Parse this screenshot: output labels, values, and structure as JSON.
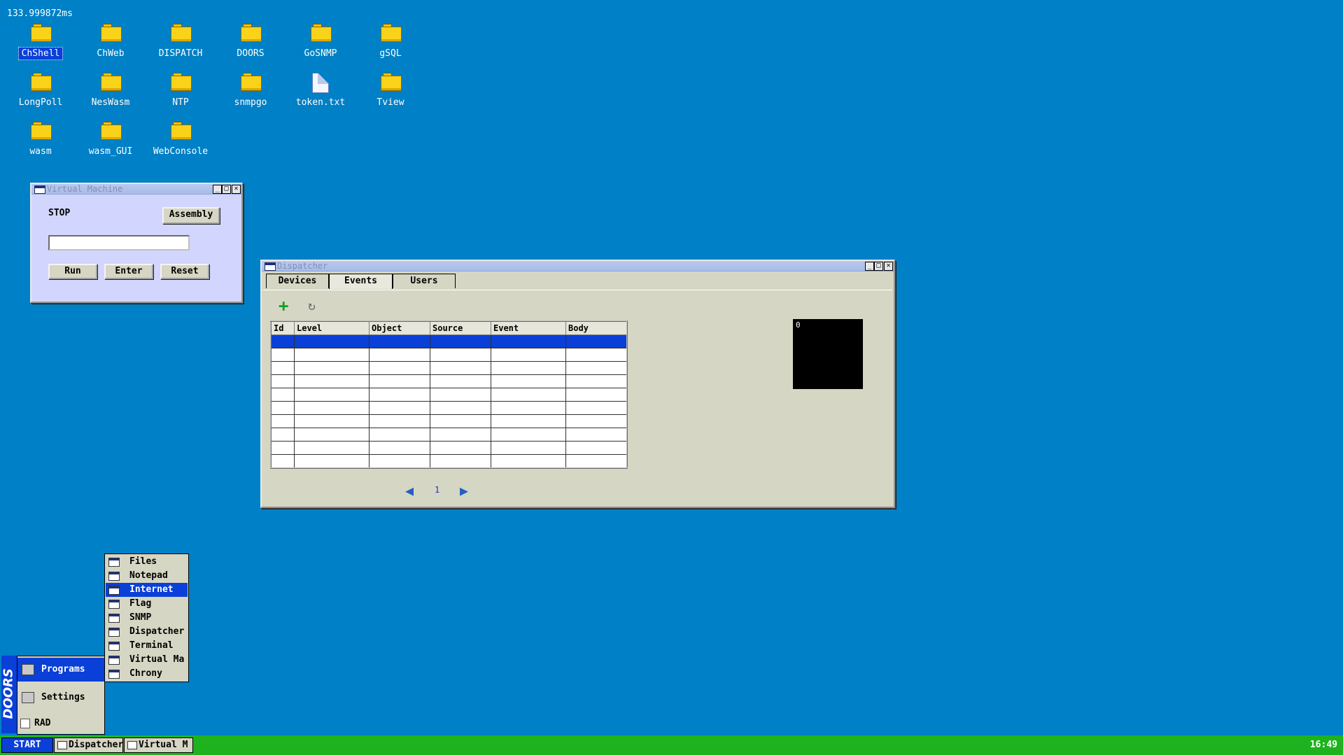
{
  "fps": "133.999872ms",
  "desktop": {
    "icons": [
      {
        "label": "ChShell",
        "type": "folder",
        "selected": true
      },
      {
        "label": "ChWeb",
        "type": "folder"
      },
      {
        "label": "DISPATCH",
        "type": "folder"
      },
      {
        "label": "DOORS",
        "type": "folder"
      },
      {
        "label": "GoSNMP",
        "type": "folder"
      },
      {
        "label": "gSQL",
        "type": "folder"
      },
      {
        "label": "LongPoll",
        "type": "folder"
      },
      {
        "label": "NesWasm",
        "type": "folder"
      },
      {
        "label": "NTP",
        "type": "folder"
      },
      {
        "label": "snmpgo",
        "type": "folder"
      },
      {
        "label": "token.txt",
        "type": "file"
      },
      {
        "label": "Tview",
        "type": "folder"
      },
      {
        "label": "wasm",
        "type": "folder"
      },
      {
        "label": "wasm_GUI",
        "type": "folder"
      },
      {
        "label": "WebConsole",
        "type": "folder"
      }
    ]
  },
  "vm": {
    "title": "Virtual Machine",
    "status": "STOP",
    "assembly": "Assembly",
    "input_value": "",
    "run": "Run",
    "enter": "Enter",
    "reset": "Reset"
  },
  "dispatcher": {
    "title": "Dispatcher",
    "tabs": [
      "Devices",
      "Events",
      "Users"
    ],
    "active_tab": "Events",
    "columns": [
      "Id",
      "Level",
      "Object",
      "Source",
      "Event",
      "Body"
    ],
    "rows": [
      [
        "",
        "",
        "",
        "",
        "",
        ""
      ],
      [
        "",
        "",
        "",
        "",
        "",
        ""
      ],
      [
        "",
        "",
        "",
        "",
        "",
        ""
      ],
      [
        "",
        "",
        "",
        "",
        "",
        ""
      ],
      [
        "",
        "",
        "",
        "",
        "",
        ""
      ],
      [
        "",
        "",
        "",
        "",
        "",
        ""
      ],
      [
        "",
        "",
        "",
        "",
        "",
        ""
      ],
      [
        "",
        "",
        "",
        "",
        "",
        ""
      ],
      [
        "",
        "",
        "",
        "",
        "",
        ""
      ],
      [
        "",
        "",
        "",
        "",
        "",
        ""
      ]
    ],
    "page": "1",
    "canvas_text": "0",
    "add_icon": "plus-icon",
    "refresh_icon": "refresh-icon"
  },
  "startmenu": {
    "brand": "DOORS",
    "items": [
      {
        "label": "Programs",
        "active": true
      },
      {
        "label": "Settings"
      }
    ],
    "rad": "RAD"
  },
  "programs": [
    {
      "label": "Files",
      "icon": "folder-icon"
    },
    {
      "label": "Notepad",
      "icon": "notepad-icon"
    },
    {
      "label": "Internet",
      "icon": "globe-icon",
      "active": true
    },
    {
      "label": "Flag",
      "icon": "window-icon"
    },
    {
      "label": "SNMP",
      "icon": "window-icon"
    },
    {
      "label": "Dispatcher",
      "icon": "window-icon"
    },
    {
      "label": "Terminal",
      "icon": "window-icon"
    },
    {
      "label": "Virtual Ma",
      "icon": "window-icon"
    },
    {
      "label": "Chrony",
      "icon": "window-icon"
    }
  ],
  "taskbar": {
    "start": "START",
    "tasks": [
      "Dispatcher",
      "Virtual M"
    ],
    "clock": "16:49"
  },
  "colors": {
    "desktop": "#0080c6",
    "taskbar": "#1eb31e",
    "selection": "#0a3fd8",
    "window": "#d6d6c4",
    "vm_window": "#d2d6fe"
  }
}
